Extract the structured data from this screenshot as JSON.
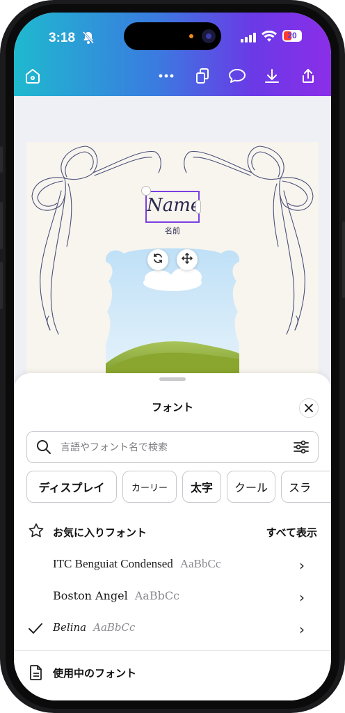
{
  "status_bar": {
    "time": "3:18",
    "battery": "20"
  },
  "toolbar": {
    "home_icon": "home-icon",
    "more_icon": "more-icon",
    "pages_icon": "pages-icon",
    "comment_icon": "comment-icon",
    "download_icon": "download-icon",
    "share_icon": "share-icon"
  },
  "canvas": {
    "title_text": "Name",
    "subtitle_text": "名前"
  },
  "font_panel": {
    "title": "フォント",
    "search_placeholder": "言語やフォント名で検索",
    "chips": [
      "ディスプレイ",
      "カーリー",
      "太字",
      "クール",
      "スラ"
    ],
    "favorites_label": "お気に入りフォント",
    "show_all_label": "すべて表示",
    "fonts": [
      {
        "name": "ITC Benguiat Condensed",
        "sample": "AaBbCc",
        "selected": false
      },
      {
        "name": "Boston Angel",
        "sample": "AaBbCc",
        "selected": false
      },
      {
        "name": "Belina",
        "sample": "AaBbCc",
        "selected": true
      }
    ],
    "in_use_label": "使用中のフォント"
  },
  "colors": {
    "brand_gradient_start": "#1fb9cf",
    "brand_gradient_end": "#8b2ee8",
    "selection": "#7b3fe4",
    "ribbon": "#4a4f7a"
  }
}
